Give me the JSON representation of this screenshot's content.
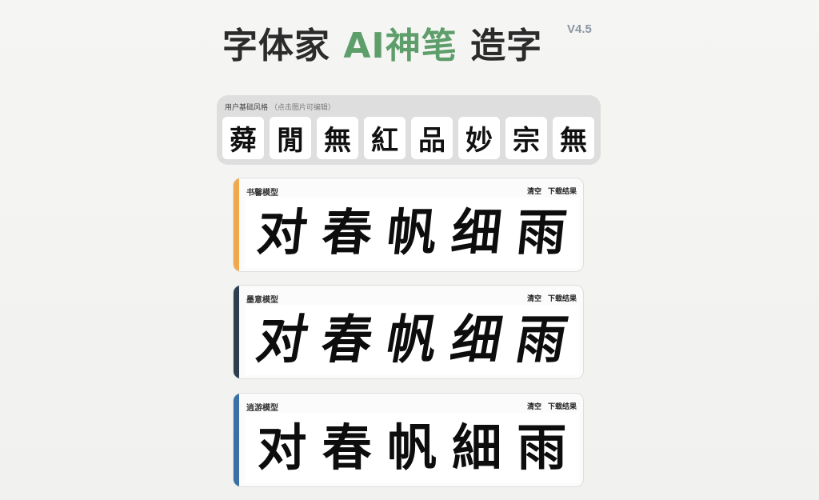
{
  "header": {
    "title_part1": "字体家",
    "title_accent": "AI神笔",
    "title_part2": "造字",
    "version": "V4.5"
  },
  "user_style": {
    "label": "用户基础风格",
    "hint": "（点击图片可编辑）",
    "chars": [
      "蕣",
      "閒",
      "無",
      "紅",
      "品",
      "妙",
      "宗",
      "無"
    ]
  },
  "models": [
    {
      "name": "书馨模型",
      "clear_label": "清空",
      "download_label": "下载结果",
      "accent": "#f0a84a",
      "chars": [
        "对",
        "春",
        "帆",
        "细",
        "雨"
      ]
    },
    {
      "name": "墨意模型",
      "clear_label": "清空",
      "download_label": "下载结果",
      "accent": "#2c3e50",
      "chars": [
        "对",
        "春",
        "帆",
        "细",
        "雨"
      ]
    },
    {
      "name": "逍游模型",
      "clear_label": "清空",
      "download_label": "下载结果",
      "accent": "#3a6fa8",
      "chars": [
        "对",
        "春",
        "帆",
        "細",
        "雨"
      ]
    }
  ]
}
